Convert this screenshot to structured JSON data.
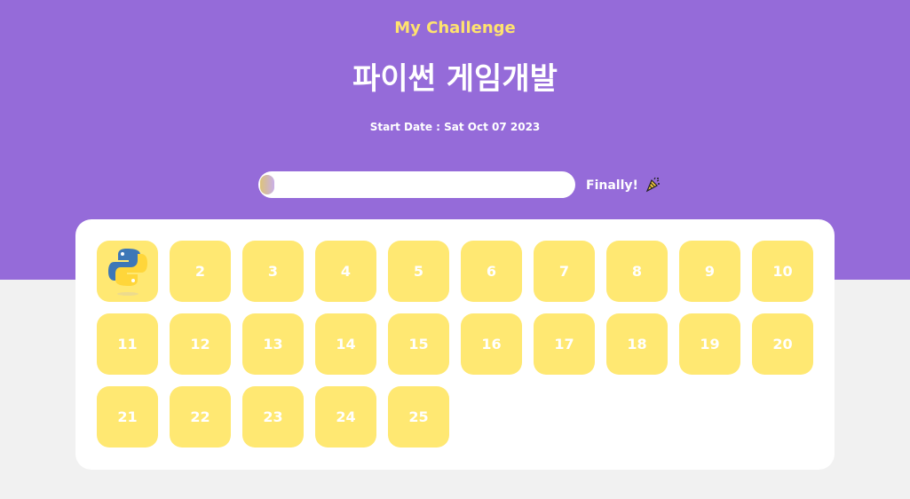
{
  "header": {
    "kicker": "My Challenge",
    "title": "파이썬 게임개발",
    "start_date": "Start Date : Sat Oct 07 2023",
    "finally_text": "Finally!",
    "finally_icon": "party-popper-icon"
  },
  "progress": {
    "value": 0.04,
    "fill_gradient": [
      "#dcc37a",
      "#c9afe7"
    ]
  },
  "board": {
    "tiles": [
      {
        "label": "",
        "done": true,
        "icon": "python-logo-icon"
      },
      {
        "label": "2",
        "done": false
      },
      {
        "label": "3",
        "done": false
      },
      {
        "label": "4",
        "done": false
      },
      {
        "label": "5",
        "done": false
      },
      {
        "label": "6",
        "done": false
      },
      {
        "label": "7",
        "done": false
      },
      {
        "label": "8",
        "done": false
      },
      {
        "label": "9",
        "done": false
      },
      {
        "label": "10",
        "done": false
      },
      {
        "label": "11",
        "done": false
      },
      {
        "label": "12",
        "done": false
      },
      {
        "label": "13",
        "done": false
      },
      {
        "label": "14",
        "done": false
      },
      {
        "label": "15",
        "done": false
      },
      {
        "label": "16",
        "done": false
      },
      {
        "label": "17",
        "done": false
      },
      {
        "label": "18",
        "done": false
      },
      {
        "label": "19",
        "done": false
      },
      {
        "label": "20",
        "done": false
      },
      {
        "label": "21",
        "done": false
      },
      {
        "label": "22",
        "done": false
      },
      {
        "label": "23",
        "done": false
      },
      {
        "label": "24",
        "done": false
      },
      {
        "label": "25",
        "done": false
      }
    ]
  },
  "colors": {
    "hero": "#956bd9",
    "kicker": "#ffe36e",
    "tile": "#ffe872",
    "background": "#f1f1f1",
    "card": "#ffffff"
  }
}
